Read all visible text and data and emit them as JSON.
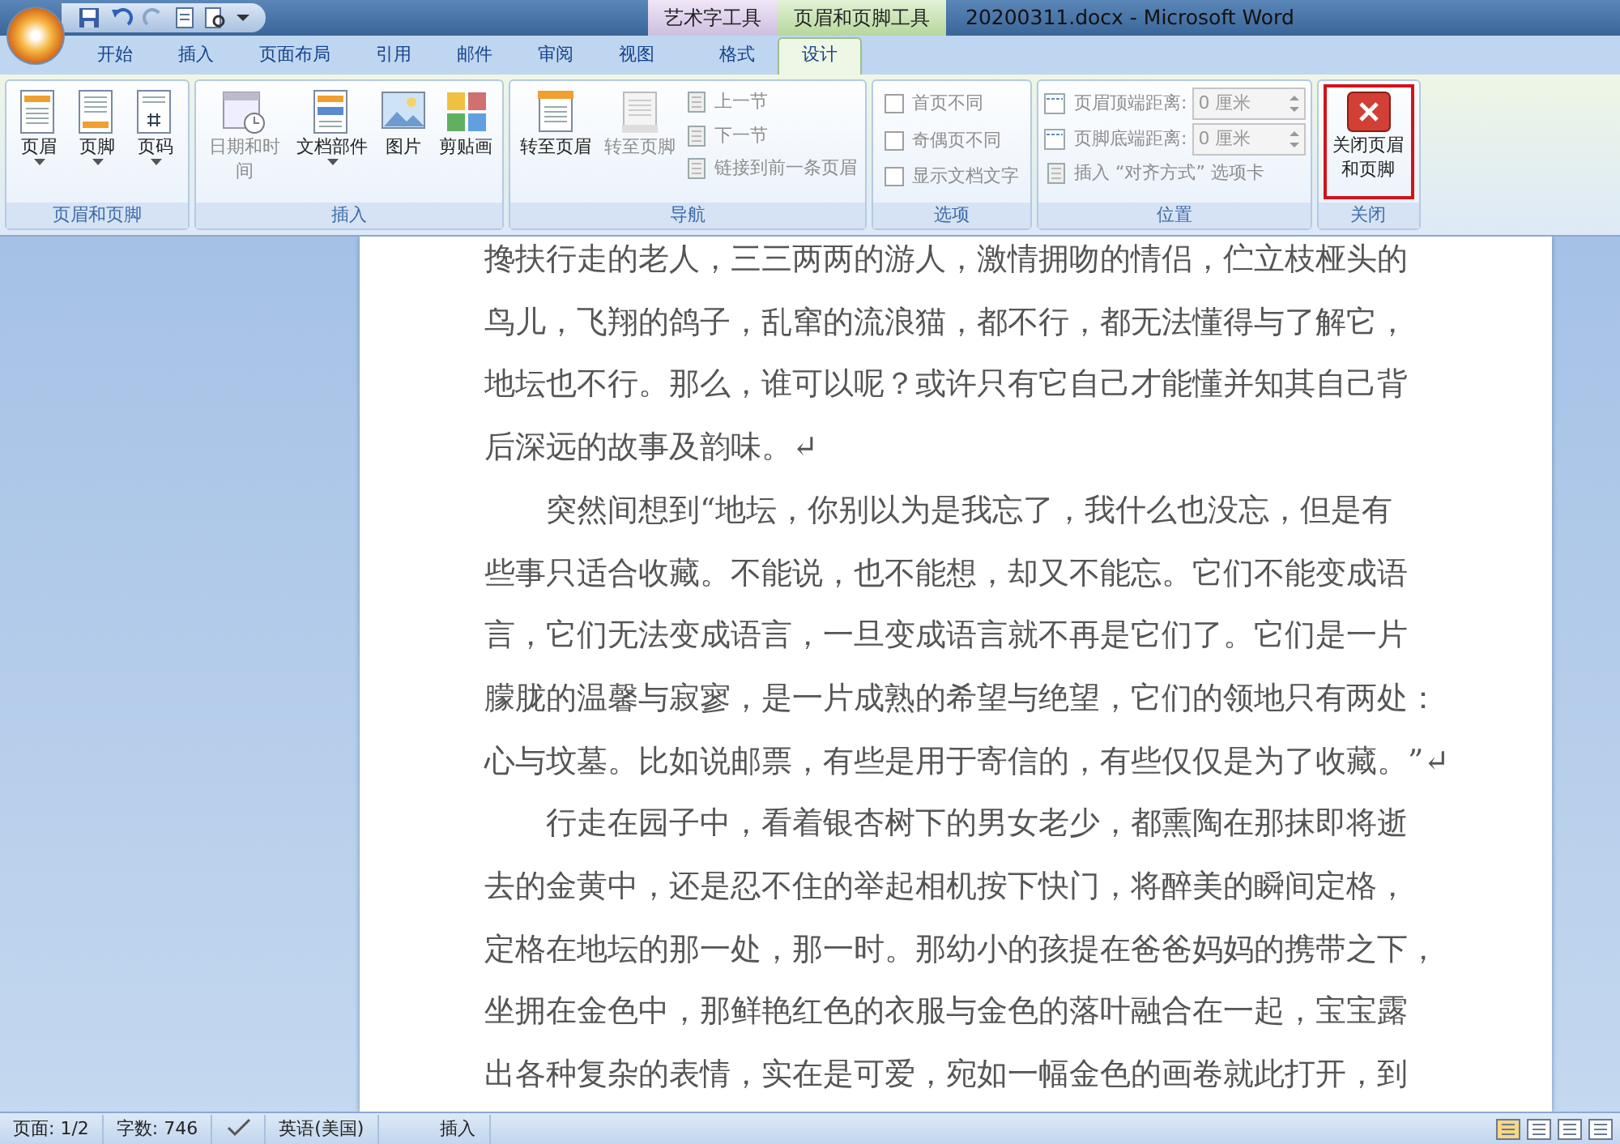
{
  "window": {
    "title": "20200311.docx - Microsoft Word",
    "context_tabs": [
      {
        "label": "艺术字工具",
        "selected": false
      },
      {
        "label": "页眉和页脚工具",
        "selected": true
      }
    ]
  },
  "tabs": [
    {
      "label": "开始",
      "selected": false
    },
    {
      "label": "插入",
      "selected": false
    },
    {
      "label": "页面布局",
      "selected": false
    },
    {
      "label": "引用",
      "selected": false
    },
    {
      "label": "邮件",
      "selected": false
    },
    {
      "label": "审阅",
      "selected": false
    },
    {
      "label": "视图",
      "selected": false
    },
    {
      "label": "格式",
      "selected": false
    },
    {
      "label": "设计",
      "selected": true
    }
  ],
  "ribbon_groups": [
    {
      "label": "页眉和页脚",
      "items": [
        {
          "kind": "large",
          "label": "页眉",
          "dropdown": true,
          "disabled": false
        },
        {
          "kind": "large",
          "label": "页脚",
          "dropdown": true,
          "disabled": false
        },
        {
          "kind": "large",
          "label": "页码",
          "dropdown": true,
          "disabled": false
        }
      ]
    },
    {
      "label": "插入",
      "items": [
        {
          "kind": "large",
          "label": "日期和时间",
          "dropdown": false,
          "disabled": true
        },
        {
          "kind": "large",
          "label": "文档部件",
          "dropdown": true,
          "disabled": false
        },
        {
          "kind": "large",
          "label": "图片",
          "dropdown": false,
          "disabled": false
        },
        {
          "kind": "large",
          "label": "剪贴画",
          "dropdown": false,
          "disabled": false
        }
      ]
    },
    {
      "label": "导航",
      "items": [
        {
          "kind": "large",
          "label": "转至页眉",
          "dropdown": false,
          "disabled": false
        },
        {
          "kind": "large",
          "label": "转至页脚",
          "dropdown": false,
          "disabled": true
        },
        {
          "kind": "small",
          "label": "上一节",
          "disabled": true
        },
        {
          "kind": "small",
          "label": "下一节",
          "disabled": true
        },
        {
          "kind": "small",
          "label": "链接到前一条页眉",
          "disabled": true
        }
      ]
    },
    {
      "label": "选项",
      "items": [
        {
          "kind": "check",
          "label": "首页不同",
          "checked": false
        },
        {
          "kind": "check",
          "label": "奇偶页不同",
          "checked": false
        },
        {
          "kind": "check",
          "label": "显示文档文字",
          "checked": false
        }
      ]
    },
    {
      "label": "位置",
      "items": [
        {
          "kind": "spin",
          "label": "页眉顶端距离:",
          "value": "0 厘米"
        },
        {
          "kind": "spin",
          "label": "页脚底端距离:",
          "value": "0 厘米"
        },
        {
          "kind": "small",
          "label": "插入 “对齐方式” 选项卡",
          "disabled": true
        }
      ]
    },
    {
      "label": "关闭",
      "items": [
        {
          "kind": "close",
          "label": "关闭页眉和页脚",
          "highlighted": true
        }
      ]
    }
  ],
  "document": {
    "lines": [
      {
        "kind": "cont",
        "text": "搀扶行走的老人，三三两两的游人，激情拥吻的情侣，伫立枝桠头的"
      },
      {
        "kind": "cont",
        "text": "鸟儿，飞翔的鸽子，乱窜的流浪猫，都不行，都无法懂得与了解它，"
      },
      {
        "kind": "cont",
        "text": "地坛也不行。那么，谁可以呢？或许只有它自己才能懂并知其自己背"
      },
      {
        "kind": "cont",
        "text": "后深远的故事及韵味。↵"
      },
      {
        "kind": "first",
        "text": "突然间想到“地坛，你别以为是我忘了，我什么也没忘，但是有"
      },
      {
        "kind": "cont",
        "text": "些事只适合收藏。不能说，也不能想，却又不能忘。它们不能变成语"
      },
      {
        "kind": "cont",
        "text": "言，它们无法变成语言，一旦变成语言就不再是它们了。它们是一片"
      },
      {
        "kind": "cont",
        "text": "朦胧的温馨与寂寥，是一片成熟的希望与绝望，它们的领地只有两处："
      },
      {
        "kind": "cont",
        "text": "心与坟墓。比如说邮票，有些是用于寄信的，有些仅仅是为了收藏。”↵"
      },
      {
        "kind": "first",
        "text": "行走在园子中，看着银杏树下的男女老少，都熏陶在那抹即将逝"
      },
      {
        "kind": "cont",
        "text": "去的金黄中，还是忍不住的举起相机按下快门，将醉美的瞬间定格，"
      },
      {
        "kind": "cont",
        "text": "定格在地坛的那一处，那一时。那幼小的孩提在爸爸妈妈的携带之下，"
      },
      {
        "kind": "cont",
        "text": "坐拥在金色中，那鲜艳红色的衣服与金色的落叶融合在一起，宝宝露"
      },
      {
        "kind": "cont",
        "text": "出各种复杂的表情，实在是可爱，宛如一幅金色的画卷就此打开，到"
      }
    ]
  },
  "status_bar": {
    "page": "页面: 1/2",
    "words": "字数: 746",
    "language": "英语(美国)",
    "mode": "插入"
  }
}
